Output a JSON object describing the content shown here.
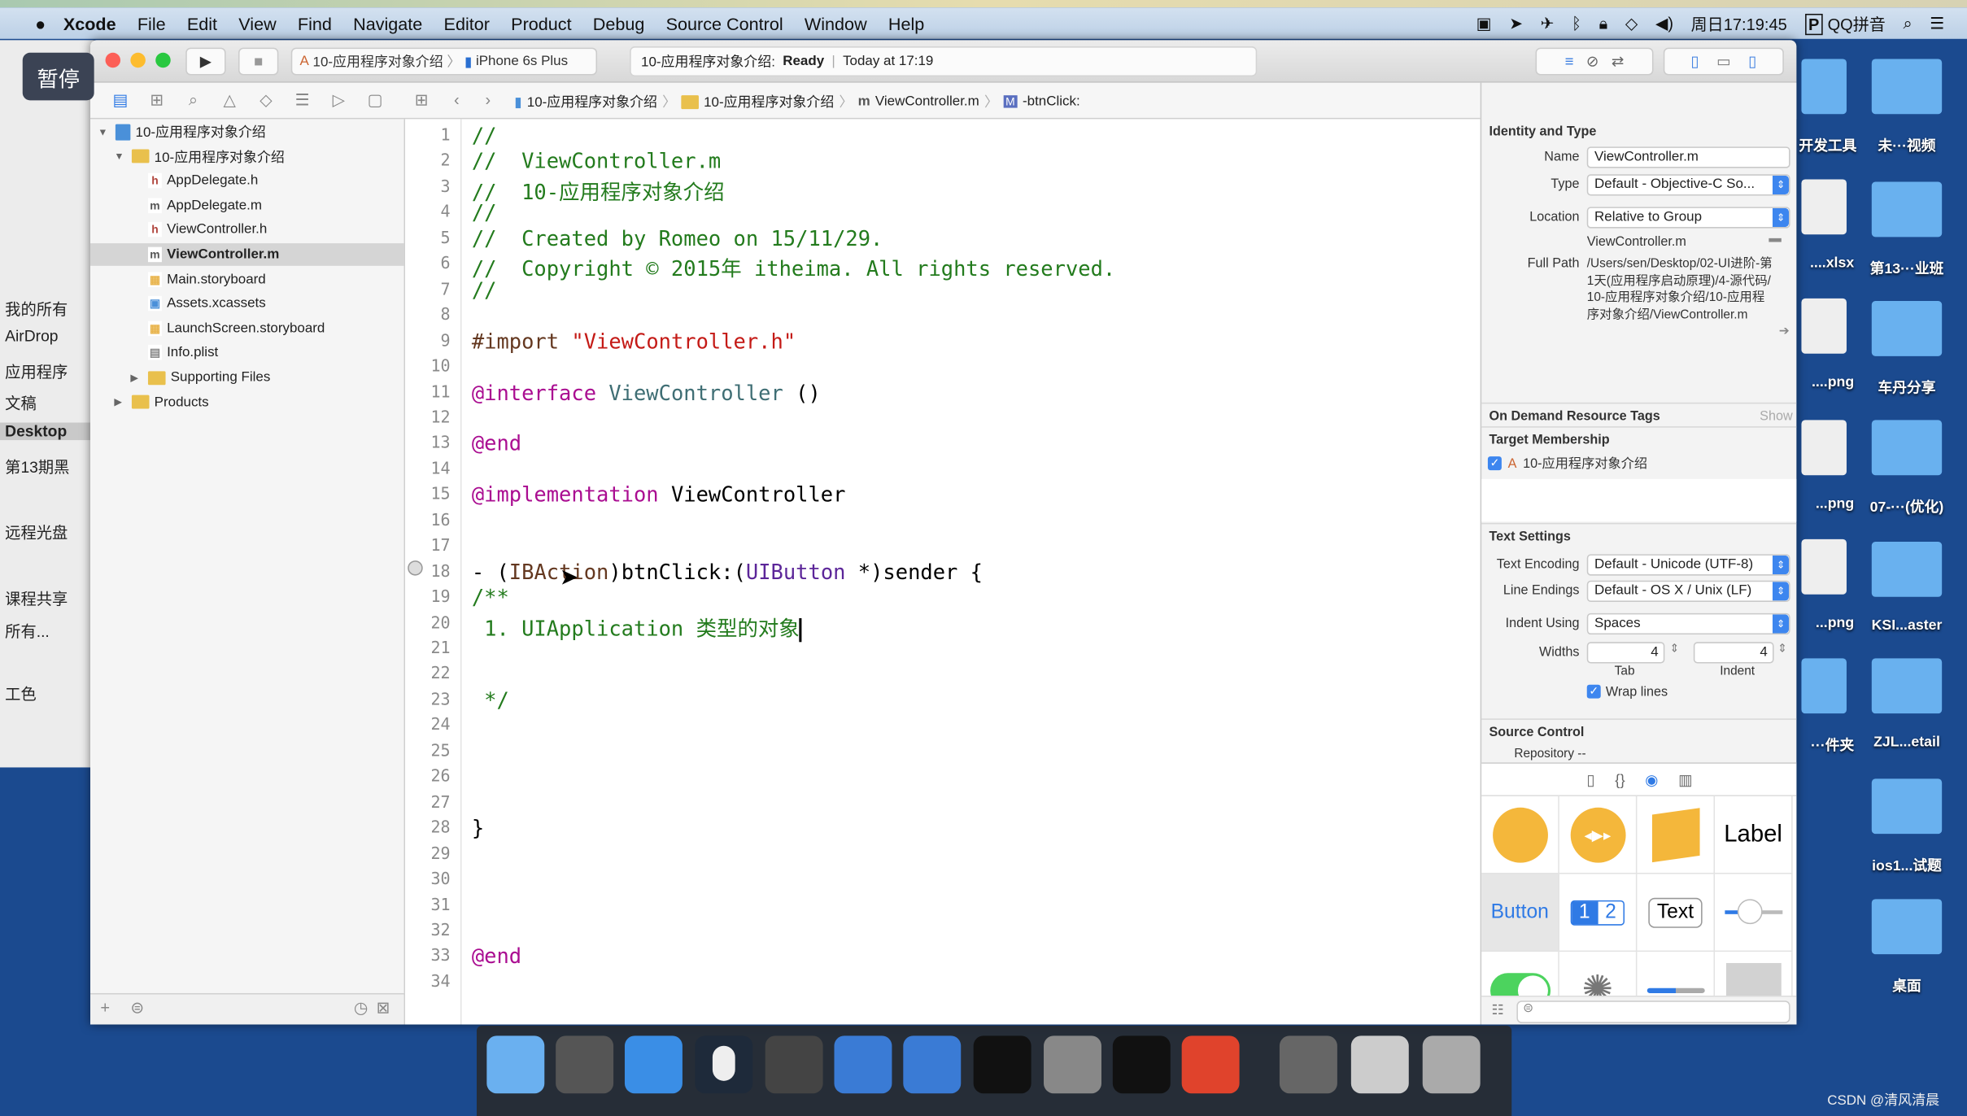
{
  "menubar": {
    "app": "Xcode",
    "items": [
      "File",
      "Edit",
      "View",
      "Find",
      "Navigate",
      "Editor",
      "Product",
      "Debug",
      "Source Control",
      "Window",
      "Help"
    ],
    "clock": "周日17:19:45",
    "input_method": "QQ拼音"
  },
  "overlay": {
    "pause": "暂停"
  },
  "finder": {
    "items": [
      "我的所有",
      "AirDrop",
      "应用程序",
      "文稿",
      "Desktop",
      "第13期黑",
      "远程光盘",
      "课程共享",
      "所有...",
      "工色"
    ],
    "selected": "Desktop"
  },
  "toolbar": {
    "scheme": "10-应用程序对象介绍",
    "device": "iPhone 6s Plus",
    "activity_project": "10-应用程序对象介绍:",
    "activity_status": "Ready",
    "activity_time": "Today at 17:19"
  },
  "jumpbar": [
    "10-应用程序对象介绍",
    "10-应用程序对象介绍",
    "ViewController.m",
    "-btnClick:"
  ],
  "navigator": {
    "items": [
      {
        "label": "10-应用程序对象介绍",
        "icon": "project",
        "level": 0,
        "disclosure": "▼"
      },
      {
        "label": "10-应用程序对象介绍",
        "icon": "folder",
        "level": 1,
        "disclosure": "▼"
      },
      {
        "label": "AppDelegate.h",
        "icon": "h",
        "level": 2
      },
      {
        "label": "AppDelegate.m",
        "icon": "m",
        "level": 2
      },
      {
        "label": "ViewController.h",
        "icon": "h",
        "level": 2
      },
      {
        "label": "ViewController.m",
        "icon": "m",
        "level": 2,
        "selected": true
      },
      {
        "label": "Main.storyboard",
        "icon": "storyboard",
        "level": 2
      },
      {
        "label": "Assets.xcassets",
        "icon": "assets",
        "level": 2
      },
      {
        "label": "LaunchScreen.storyboard",
        "icon": "storyboard",
        "level": 2
      },
      {
        "label": "Info.plist",
        "icon": "plist",
        "level": 2
      },
      {
        "label": "Supporting Files",
        "icon": "folder",
        "level": 2,
        "disclosure": "▶"
      },
      {
        "label": "Products",
        "icon": "folder",
        "level": 1,
        "disclosure": "▶"
      }
    ]
  },
  "editor": {
    "lines": [
      [
        [
          "//",
          "comment"
        ]
      ],
      [
        [
          "//  ViewController.m",
          "comment"
        ]
      ],
      [
        [
          "//  10-应用程序对象介绍",
          "comment"
        ]
      ],
      [
        [
          "//",
          "comment"
        ]
      ],
      [
        [
          "//  Created by Romeo on 15/11/29.",
          "comment"
        ]
      ],
      [
        [
          "//  Copyright © 2015年 itheima. All rights reserved.",
          "comment"
        ]
      ],
      [
        [
          "//",
          "comment"
        ]
      ],
      [],
      [
        [
          "#import ",
          "pre"
        ],
        [
          "\"ViewController.h\"",
          "str"
        ]
      ],
      [],
      [
        [
          "@interface ",
          "kw"
        ],
        [
          "ViewController",
          "cls"
        ],
        [
          " ()",
          "plain"
        ]
      ],
      [],
      [
        [
          "@end",
          "kw"
        ]
      ],
      [],
      [
        [
          "@implementation ",
          "kw"
        ],
        [
          "ViewController",
          "plain"
        ]
      ],
      [],
      [],
      [
        [
          "- (",
          "plain"
        ],
        [
          "IBAction",
          "pre"
        ],
        [
          ")btnClick:(",
          "plain"
        ],
        [
          "UIButton",
          "type"
        ],
        [
          " *)sender {",
          "plain"
        ]
      ],
      [
        [
          "/**",
          "comment"
        ]
      ],
      [
        [
          " 1. UIApplication 类型的对象",
          "comment"
        ]
      ],
      [],
      [],
      [
        [
          " */",
          "comment"
        ]
      ],
      [],
      [],
      [],
      [],
      [
        [
          "}",
          "plain"
        ]
      ],
      [],
      [],
      [],
      [],
      [
        [
          "@end",
          "kw"
        ]
      ],
      []
    ]
  },
  "inspector": {
    "identity": {
      "title": "Identity and Type",
      "name_label": "Name",
      "name": "ViewController.m",
      "type_label": "Type",
      "type": "Default - Objective-C So...",
      "location_label": "Location",
      "location": "Relative to Group",
      "location_file": "ViewController.m",
      "fullpath_label": "Full Path",
      "fullpath": "/Users/sen/Desktop/02-UI进阶-第1天(应用程序启动原理)/4-源代码/10-应用程序对象介绍/10-应用程序对象介绍/ViewController.m"
    },
    "odr": {
      "title": "On Demand Resource Tags",
      "show": "Show"
    },
    "target": {
      "title": "Target Membership",
      "item": "10-应用程序对象介绍",
      "checked": true
    },
    "text": {
      "title": "Text Settings",
      "enc_label": "Text Encoding",
      "enc": "Default - Unicode (UTF-8)",
      "le_label": "Line Endings",
      "le": "Default - OS X / Unix (LF)",
      "indent_label": "Indent Using",
      "indent": "Spaces",
      "widths_label": "Widths",
      "tab": "4",
      "indent_w": "4",
      "tab_label": "Tab",
      "indent_w_label": "Indent",
      "wrap": "Wrap lines",
      "wrap_checked": true
    },
    "sc": {
      "title": "Source Control",
      "repo": "Repository  --"
    },
    "library": {
      "label": "Label",
      "button": "Button",
      "seg1": "1",
      "seg2": "2",
      "text": "Text"
    }
  },
  "desktop": {
    "left": [
      "开发工具",
      "....xlsx",
      "....png",
      "...png",
      "...png",
      "···件夹"
    ],
    "right": [
      "未···视频",
      "第13···业班",
      "车丹分享",
      "07-···(优化)",
      "KSI...aster",
      "ZJL...etail",
      "ios1...试题",
      "桌面"
    ]
  },
  "watermark": "CSDN @清风清晨"
}
